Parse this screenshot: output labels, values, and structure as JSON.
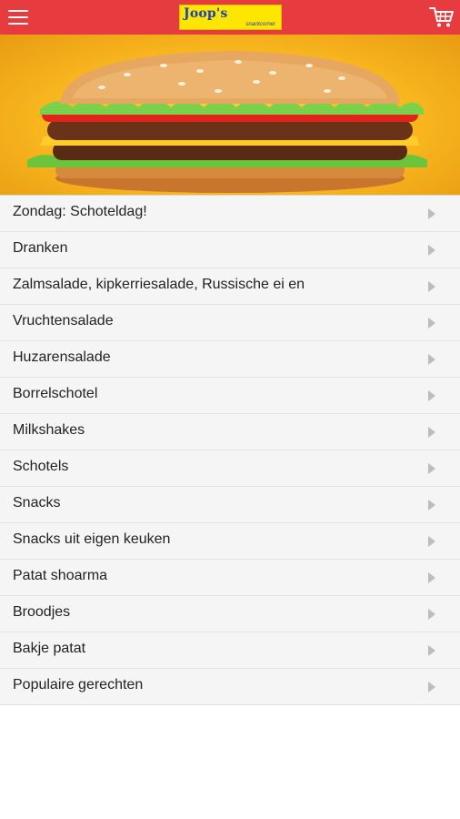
{
  "header": {
    "logo_name": "Joop's",
    "logo_subtitle": "snackcorner",
    "menu_icon": "hamburger-menu-icon",
    "cart_icon": "shopping-cart-icon",
    "bar_color": "#e63b3f"
  },
  "hero": {
    "image": "burger-banner"
  },
  "categories": [
    {
      "label": "Zondag: Schoteldag!"
    },
    {
      "label": "Dranken"
    },
    {
      "label": "Zalmsalade, kipkerriesalade, Russische ei en"
    },
    {
      "label": "Vruchtensalade"
    },
    {
      "label": "Huzarensalade"
    },
    {
      "label": "Borrelschotel"
    },
    {
      "label": "Milkshakes"
    },
    {
      "label": "Schotels"
    },
    {
      "label": "Snacks"
    },
    {
      "label": "Snacks uit eigen keuken"
    },
    {
      "label": "Patat shoarma"
    },
    {
      "label": "Broodjes"
    },
    {
      "label": "Bakje patat"
    },
    {
      "label": "Populaire gerechten"
    }
  ]
}
